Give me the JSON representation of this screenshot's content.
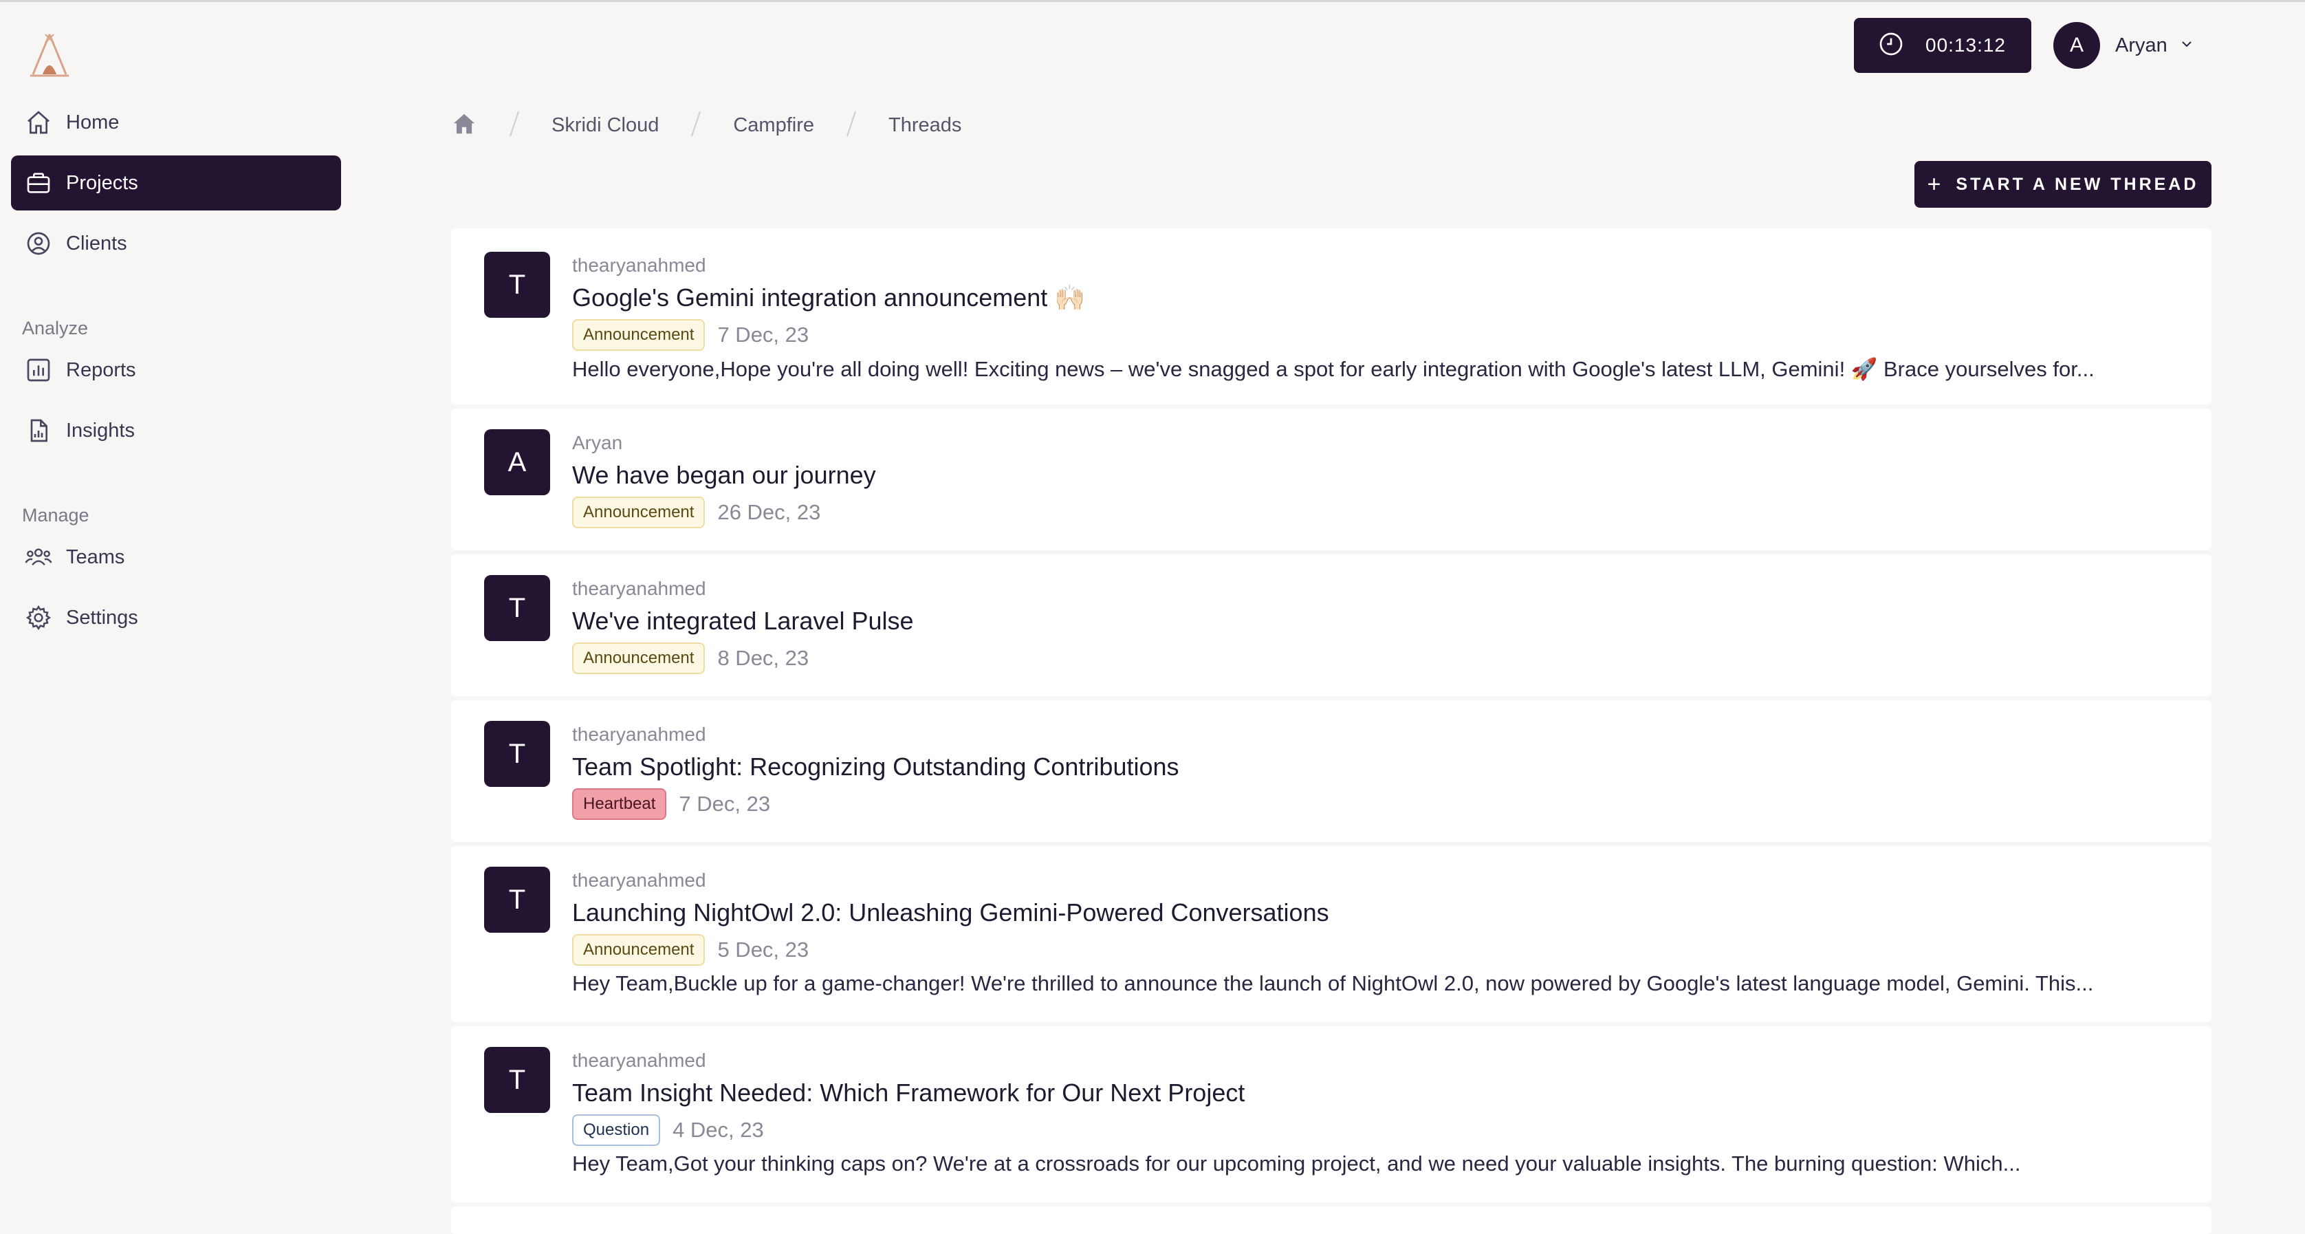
{
  "timer": {
    "value": "00:13:12"
  },
  "user": {
    "initial": "A",
    "name": "Aryan"
  },
  "sidebar": {
    "items": [
      {
        "label": "Home",
        "icon": "home-icon"
      },
      {
        "label": "Projects",
        "icon": "briefcase-icon",
        "active": true
      },
      {
        "label": "Clients",
        "icon": "user-circle-icon"
      }
    ],
    "analyze_label": "Analyze",
    "analyze_items": [
      {
        "label": "Reports",
        "icon": "bar-chart-icon"
      },
      {
        "label": "Insights",
        "icon": "document-chart-icon"
      }
    ],
    "manage_label": "Manage",
    "manage_items": [
      {
        "label": "Teams",
        "icon": "users-icon"
      },
      {
        "label": "Settings",
        "icon": "gear-icon"
      }
    ]
  },
  "breadcrumb": [
    "Skridi Cloud",
    "Campfire",
    "Threads"
  ],
  "new_thread_label": "START A NEW THREAD",
  "threads": [
    {
      "initial": "T",
      "author": "thearyanahmed",
      "title": "Google's Gemini integration announcement 🙌🏻",
      "tag": "Announcement",
      "date": "7 Dec, 23",
      "excerpt": "Hello everyone,Hope you're all doing well! Exciting news – we've snagged a spot for early integration with Google's latest LLM, Gemini! 🚀 Brace yourselves for..."
    },
    {
      "initial": "A",
      "author": "Aryan",
      "title": "We have began our journey",
      "tag": "Announcement",
      "date": "26 Dec, 23",
      "excerpt": ""
    },
    {
      "initial": "T",
      "author": "thearyanahmed",
      "title": "We've integrated Laravel Pulse",
      "tag": "Announcement",
      "date": "8 Dec, 23",
      "excerpt": ""
    },
    {
      "initial": "T",
      "author": "thearyanahmed",
      "title": "Team Spotlight: Recognizing Outstanding Contributions",
      "tag": "Heartbeat",
      "date": "7 Dec, 23",
      "excerpt": ""
    },
    {
      "initial": "T",
      "author": "thearyanahmed",
      "title": "Launching NightOwl 2.0: Unleashing Gemini-Powered Conversations",
      "tag": "Announcement",
      "date": "5 Dec, 23",
      "excerpt": "Hey Team,Buckle up for a game-changer! We're thrilled to announce the launch of NightOwl 2.0, now powered by Google's latest language model, Gemini. This..."
    },
    {
      "initial": "T",
      "author": "thearyanahmed",
      "title": "Team Insight Needed: Which Framework for Our Next Project",
      "tag": "Question",
      "date": "4 Dec, 23",
      "excerpt": "Hey Team,Got your thinking caps on? We're at a crossroads for our upcoming project, and we need your valuable insights. The burning question: Which..."
    }
  ]
}
